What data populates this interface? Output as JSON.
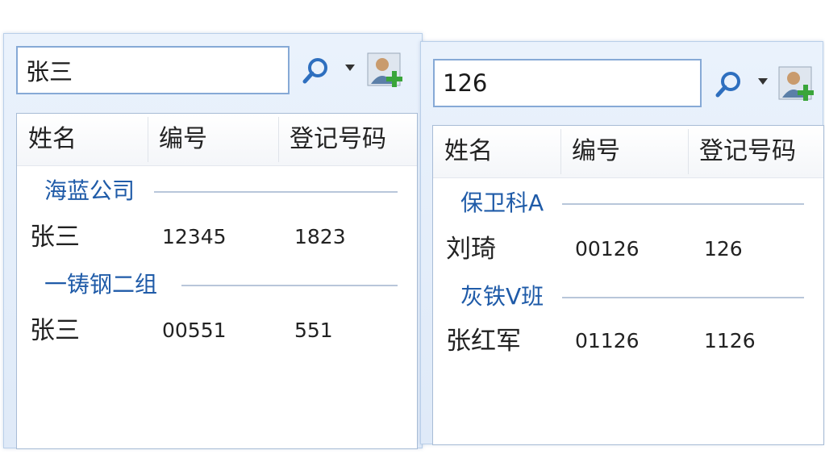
{
  "panels": [
    {
      "search": {
        "value": "张三"
      },
      "columns": [
        "姓名",
        "编号",
        "登记号码"
      ],
      "groups": [
        {
          "title": "海蓝公司",
          "rows": [
            {
              "name": "张三",
              "id": "12345",
              "reg": "1823"
            }
          ]
        },
        {
          "title": "一铸钢二组",
          "rows": [
            {
              "name": "张三",
              "id": "00551",
              "reg": "551"
            }
          ]
        }
      ]
    },
    {
      "search": {
        "value": "126"
      },
      "columns": [
        "姓名",
        "编号",
        "登记号码"
      ],
      "groups": [
        {
          "title": "保卫科A",
          "rows": [
            {
              "name": "刘琦",
              "id": "00126",
              "reg": "126"
            }
          ]
        },
        {
          "title": "灰铁V班",
          "rows": [
            {
              "name": "张红军",
              "id": "01126",
              "reg": "1126"
            }
          ]
        }
      ]
    }
  ],
  "icons": {
    "search": "search-icon",
    "dropdown": "dropdown-arrow-icon",
    "contact": "add-contact-icon"
  },
  "colors": {
    "group_title": "#1f5ba8",
    "search_border": "#86a9d6",
    "panel_bg": "#e4eefb"
  }
}
